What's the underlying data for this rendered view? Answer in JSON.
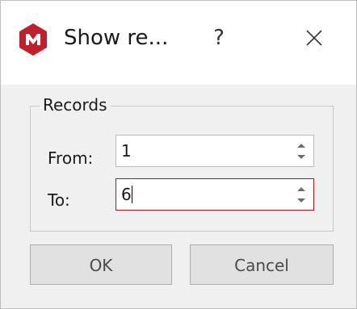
{
  "window": {
    "title": "Show re...",
    "help_label": "?",
    "icon": "app-logo-icon",
    "close_icon": "close-icon",
    "accent_color": "#c0202c"
  },
  "records": {
    "group_label": "Records",
    "from_label": "From:",
    "from_value": "1",
    "to_label": "To:",
    "to_value": "6"
  },
  "buttons": {
    "ok_label": "OK",
    "cancel_label": "Cancel"
  }
}
